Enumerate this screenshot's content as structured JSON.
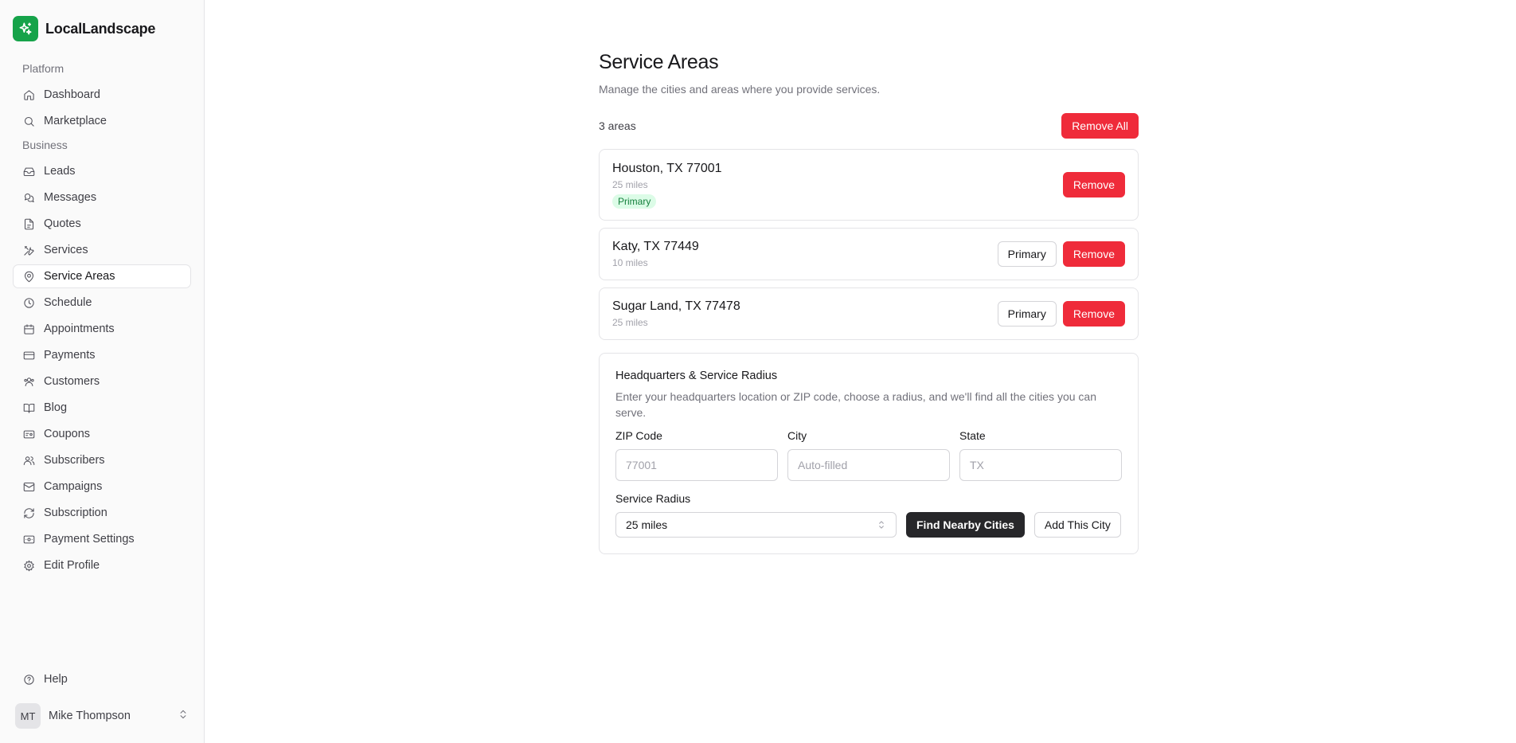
{
  "brand": {
    "name": "LocalLandscape",
    "accent": "#16a34a"
  },
  "sidebar": {
    "groups": [
      {
        "label": "Platform",
        "items": [
          {
            "label": "Dashboard",
            "icon": "home-icon"
          },
          {
            "label": "Marketplace",
            "icon": "search-icon"
          }
        ]
      },
      {
        "label": "Business",
        "items": [
          {
            "label": "Leads",
            "icon": "inbox-icon"
          },
          {
            "label": "Messages",
            "icon": "messages-icon"
          },
          {
            "label": "Quotes",
            "icon": "file-icon"
          },
          {
            "label": "Services",
            "icon": "tools-icon"
          },
          {
            "label": "Service Areas",
            "icon": "map-pin-icon",
            "active": true
          },
          {
            "label": "Schedule",
            "icon": "clock-icon"
          },
          {
            "label": "Appointments",
            "icon": "calendar-icon"
          },
          {
            "label": "Payments",
            "icon": "credit-card-icon"
          },
          {
            "label": "Customers",
            "icon": "users-group-icon"
          },
          {
            "label": "Blog",
            "icon": "book-icon"
          },
          {
            "label": "Coupons",
            "icon": "ticket-icon"
          },
          {
            "label": "Subscribers",
            "icon": "users-icon"
          },
          {
            "label": "Campaigns",
            "icon": "mail-icon"
          },
          {
            "label": "Subscription",
            "icon": "refresh-icon"
          },
          {
            "label": "Payment Settings",
            "icon": "wallet-icon"
          },
          {
            "label": "Edit Profile",
            "icon": "gear-icon"
          }
        ]
      }
    ],
    "help": {
      "label": "Help",
      "icon": "help-circle-icon"
    },
    "user": {
      "initials": "MT",
      "name": "Mike Thompson"
    }
  },
  "page": {
    "title": "Service Areas",
    "subtitle": "Manage the cities and areas where you provide services.",
    "count_label": "3 areas",
    "remove_all_label": "Remove All",
    "remove_label": "Remove",
    "primary_button_label": "Primary",
    "primary_badge_label": "Primary",
    "danger_color": "#ef2b3a"
  },
  "areas": [
    {
      "name": "Houston, TX 77001",
      "radius": "25 miles",
      "primary": true
    },
    {
      "name": "Katy, TX 77449",
      "radius": "10 miles",
      "primary": false
    },
    {
      "name": "Sugar Land, TX 77478",
      "radius": "25 miles",
      "primary": false
    }
  ],
  "hq": {
    "title": "Headquarters & Service Radius",
    "description": "Enter your headquarters location or ZIP code, choose a radius, and we'll find all the cities you can serve.",
    "zip_label": "ZIP Code",
    "zip_placeholder": "77001",
    "zip_value": "",
    "city_label": "City",
    "city_placeholder": "Auto-filled",
    "city_value": "",
    "state_label": "State",
    "state_placeholder": "TX",
    "state_value": "",
    "radius_label": "Service Radius",
    "radius_value": "25 miles",
    "find_button": "Find Nearby Cities",
    "add_button": "Add This City"
  }
}
